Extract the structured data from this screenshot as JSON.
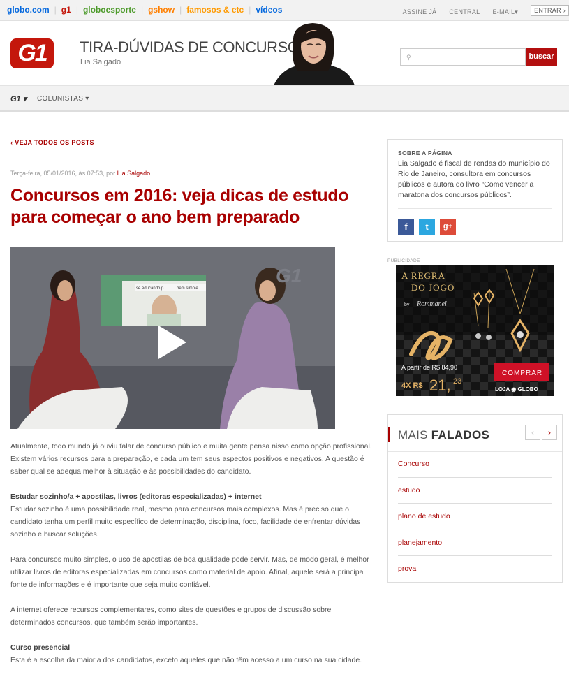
{
  "topbar": {
    "links": [
      {
        "label": "globo.com",
        "color": "#0669de"
      },
      {
        "label": "g1",
        "color": "#c4170c"
      },
      {
        "label": "globoesporte",
        "color": "#4c9a2a"
      },
      {
        "label": "gshow",
        "color": "#ff7f00"
      },
      {
        "label": "famosos & etc",
        "color": "#ff9a00"
      },
      {
        "label": "vídeos",
        "color": "#0669de"
      }
    ],
    "right": [
      "ASSINE JÁ",
      "CENTRAL",
      "E-MAIL▾"
    ],
    "entrar": "ENTRAR ›"
  },
  "header": {
    "logo": "G1",
    "title": "TIRA-DÚVIDAS DE CONCURSOS",
    "author": "Lia Salgado",
    "search_placeholder": "",
    "search_button": "buscar"
  },
  "subnav": {
    "g1": "G1 ▾",
    "colunistas": "COLUNISTAS ▾"
  },
  "article": {
    "back": "‹ VEJA TODOS OS POSTS",
    "meta_date": "Terça-feira, 05/01/2016, às 07:53, por",
    "meta_author": "Lia Salgado",
    "headline": "Concursos em 2016: veja dicas de estudo para começar o ano bem preparado",
    "video_caption": "se educando p...",
    "video_caption2": "bem simple",
    "p1": "Atualmente, todo mundo já ouviu falar de concurso público e muita gente pensa nisso como opção profissional. Existem vários recursos para a preparação, e cada um tem seus aspectos positivos e negativos. A questão é saber qual se adequa melhor à situação e às possibilidades do candidato.",
    "s1": "Estudar sozinho/a + apostilas, livros (editoras especializadas) + internet",
    "p2": "Estudar sozinho é uma possibilidade real, mesmo para concursos mais complexos. Mas é preciso que o candidato tenha um perfil muito específico de determinação, disciplina, foco, facilidade de enfrentar dúvidas sozinho e buscar soluções.",
    "p3": "Para concursos muito simples, o uso de apostilas de boa qualidade pode servir. Mas, de modo geral, é melhor utilizar livros de editoras especializadas em concursos como material de apoio. Afinal, aquele será a principal fonte de informações e é importante que seja muito confiável.",
    "p4": "A internet oferece recursos complementares, como sites de questões e grupos de discussão sobre determinados concursos, que também serão importantes.",
    "s2": "Curso presencial",
    "p5": "Esta é a escolha da maioria dos candidatos, exceto aqueles que não têm acesso a um curso na sua cidade."
  },
  "sidebar": {
    "about_label": "SOBRE A PÁGINA",
    "about_text": "Lia Salgado é fiscal de rendas do município do Rio de Janeiro, consultora em concursos públicos e autora do livro “Como vencer a maratona dos concursos públicos”.",
    "social": [
      {
        "glyph": "f",
        "color": "#3b5998"
      },
      {
        "glyph": "t",
        "color": "#2ca7e0"
      },
      {
        "glyph": "g+",
        "color": "#dd4b39"
      }
    ],
    "ad_label": "PUBLICIDADE",
    "ad": {
      "title1": "A REGRA",
      "title2": "DO JOGO",
      "by": "by",
      "brand": "Rommanel",
      "price_from": "A partir de R$ 84,90",
      "installments": "4X R$",
      "price": "21,",
      "cents": "23",
      "cta": "COMPRAR",
      "store": "LOJA ◉ GLOBO"
    },
    "mais_prefix": "MAIS",
    "mais_bold": "FALADOS",
    "mais_items": [
      "Concurso",
      "estudo",
      "plano de estudo",
      "planejamento",
      "prova"
    ]
  }
}
